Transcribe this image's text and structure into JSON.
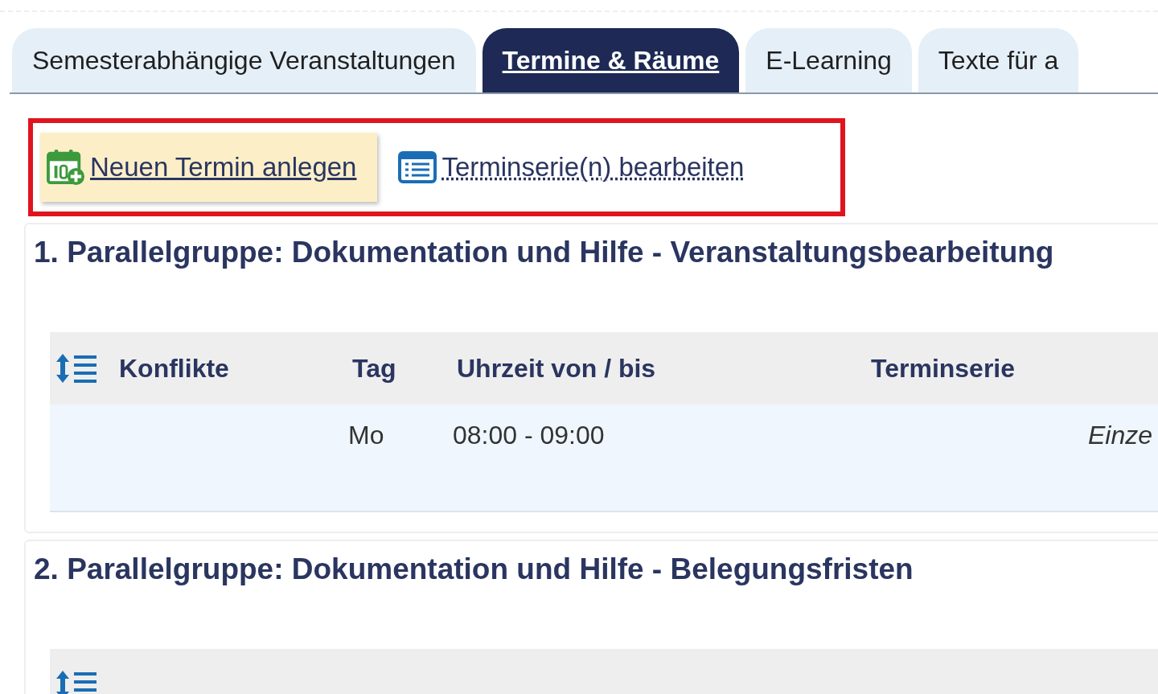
{
  "tabs": [
    {
      "label": "Semesterabhängige Veranstaltungen",
      "selected": false
    },
    {
      "label": "Termine & Räume",
      "selected": true
    },
    {
      "label": "E-Learning",
      "selected": false
    },
    {
      "label": "Texte für a",
      "selected": false
    }
  ],
  "toolbar": [
    {
      "kind": "new",
      "label": "Neuen Termin anlegen",
      "highlighted": true
    },
    {
      "kind": "series",
      "label": "Terminserie(n) bearbeiten",
      "highlighted": false
    }
  ],
  "groups": [
    {
      "title": "1. Parallelgruppe: Dokumentation und Hilfe - Veranstaltungsbearbeitung",
      "columns": [
        "Konflikte",
        "Tag",
        "Uhrzeit von / bis",
        "Terminserie"
      ],
      "rows": [
        {
          "cells": [
            "",
            "Mo",
            "08:00 - 09:00",
            "",
            "Einze"
          ]
        }
      ]
    },
    {
      "title": "2. Parallelgruppe: Dokumentation und Hilfe - Belegungsfristen"
    }
  ]
}
